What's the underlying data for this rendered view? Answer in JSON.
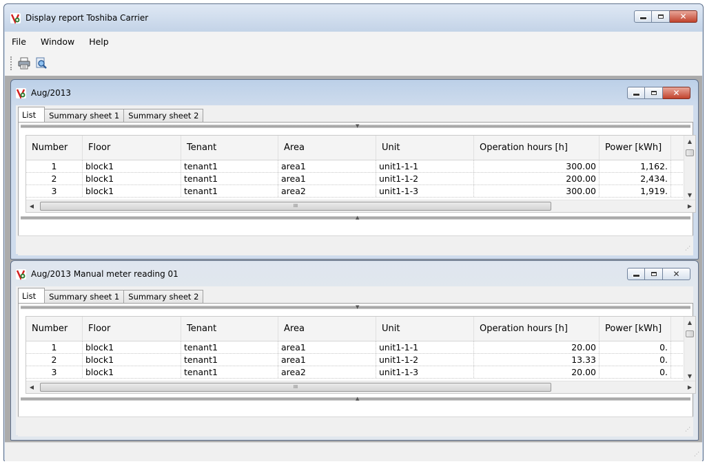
{
  "app": {
    "title": "Display report  Toshiba Carrier",
    "menu": [
      "File",
      "Window",
      "Help"
    ],
    "toolbar": [
      {
        "icon": "print-icon",
        "label": ""
      },
      {
        "icon": "preview-icon",
        "label": ""
      }
    ]
  },
  "colors": {
    "title_active": "#bcd0e8",
    "title_inactive": "#dfe6ef",
    "close_active": "#c1432d",
    "mdi_background": "#ababab"
  },
  "windows": [
    {
      "title": "Aug/2013",
      "active": true,
      "tabs": [
        "List",
        "Summary sheet 1",
        "Summary sheet 2"
      ],
      "active_tab": "List",
      "columns": [
        "Number",
        "Floor",
        "Tenant",
        "Area",
        "Unit",
        "Operation hours [h]",
        "Power [kWh]"
      ],
      "rows": [
        [
          "1",
          "block1",
          "tenant1",
          "area1",
          "unit1-1-1",
          "300.00",
          "1,162."
        ],
        [
          "2",
          "block1",
          "tenant1",
          "area1",
          "unit1-1-2",
          "200.00",
          "2,434."
        ],
        [
          "3",
          "block1",
          "tenant1",
          "area2",
          "unit1-1-3",
          "300.00",
          "1,919."
        ]
      ]
    },
    {
      "title": "Aug/2013 Manual meter reading 01",
      "active": false,
      "tabs": [
        "List",
        "Summary sheet 1",
        "Summary sheet 2"
      ],
      "active_tab": "List",
      "columns": [
        "Number",
        "Floor",
        "Tenant",
        "Area",
        "Unit",
        "Operation hours [h]",
        "Power [kWh]"
      ],
      "rows": [
        [
          "1",
          "block1",
          "tenant1",
          "area1",
          "unit1-1-1",
          "20.00",
          "0."
        ],
        [
          "2",
          "block1",
          "tenant1",
          "area1",
          "unit1-1-2",
          "13.33",
          "0."
        ],
        [
          "3",
          "block1",
          "tenant1",
          "area2",
          "unit1-1-3",
          "20.00",
          "0."
        ]
      ]
    }
  ],
  "scroll_glyphs": {
    "up": "▲",
    "down": "▼",
    "left": "◀",
    "right": "▶",
    "grip": "III"
  }
}
